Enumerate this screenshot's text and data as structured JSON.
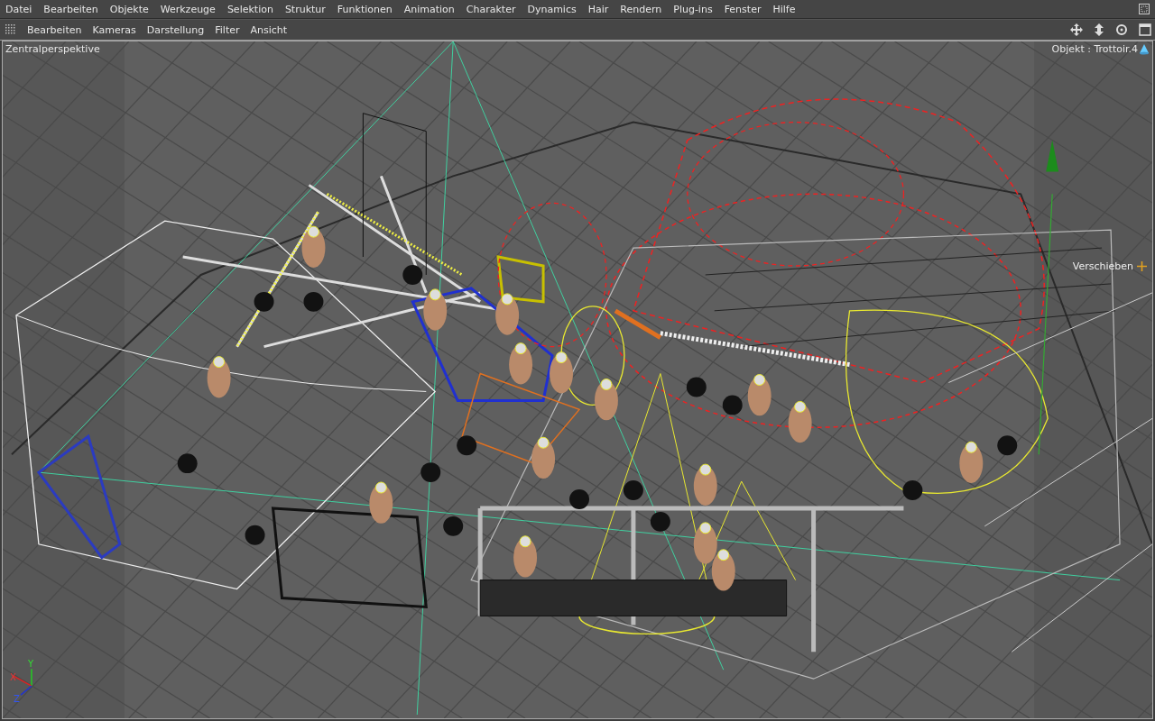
{
  "menu": [
    "Datei",
    "Bearbeiten",
    "Objekte",
    "Werkzeuge",
    "Selektion",
    "Struktur",
    "Funktionen",
    "Animation",
    "Charakter",
    "Dynamics",
    "Hair",
    "Rendern",
    "Plug-ins",
    "Fenster",
    "Hilfe"
  ],
  "viewport_menu": [
    "Bearbeiten",
    "Kameras",
    "Darstellung",
    "Filter",
    "Ansicht"
  ],
  "viewport": {
    "camera": "Zentralperspektive",
    "object_label": "Objekt : Trottoir.4",
    "tool_hint": "Verschieben",
    "axes": [
      "X",
      "Y",
      "Z"
    ]
  }
}
